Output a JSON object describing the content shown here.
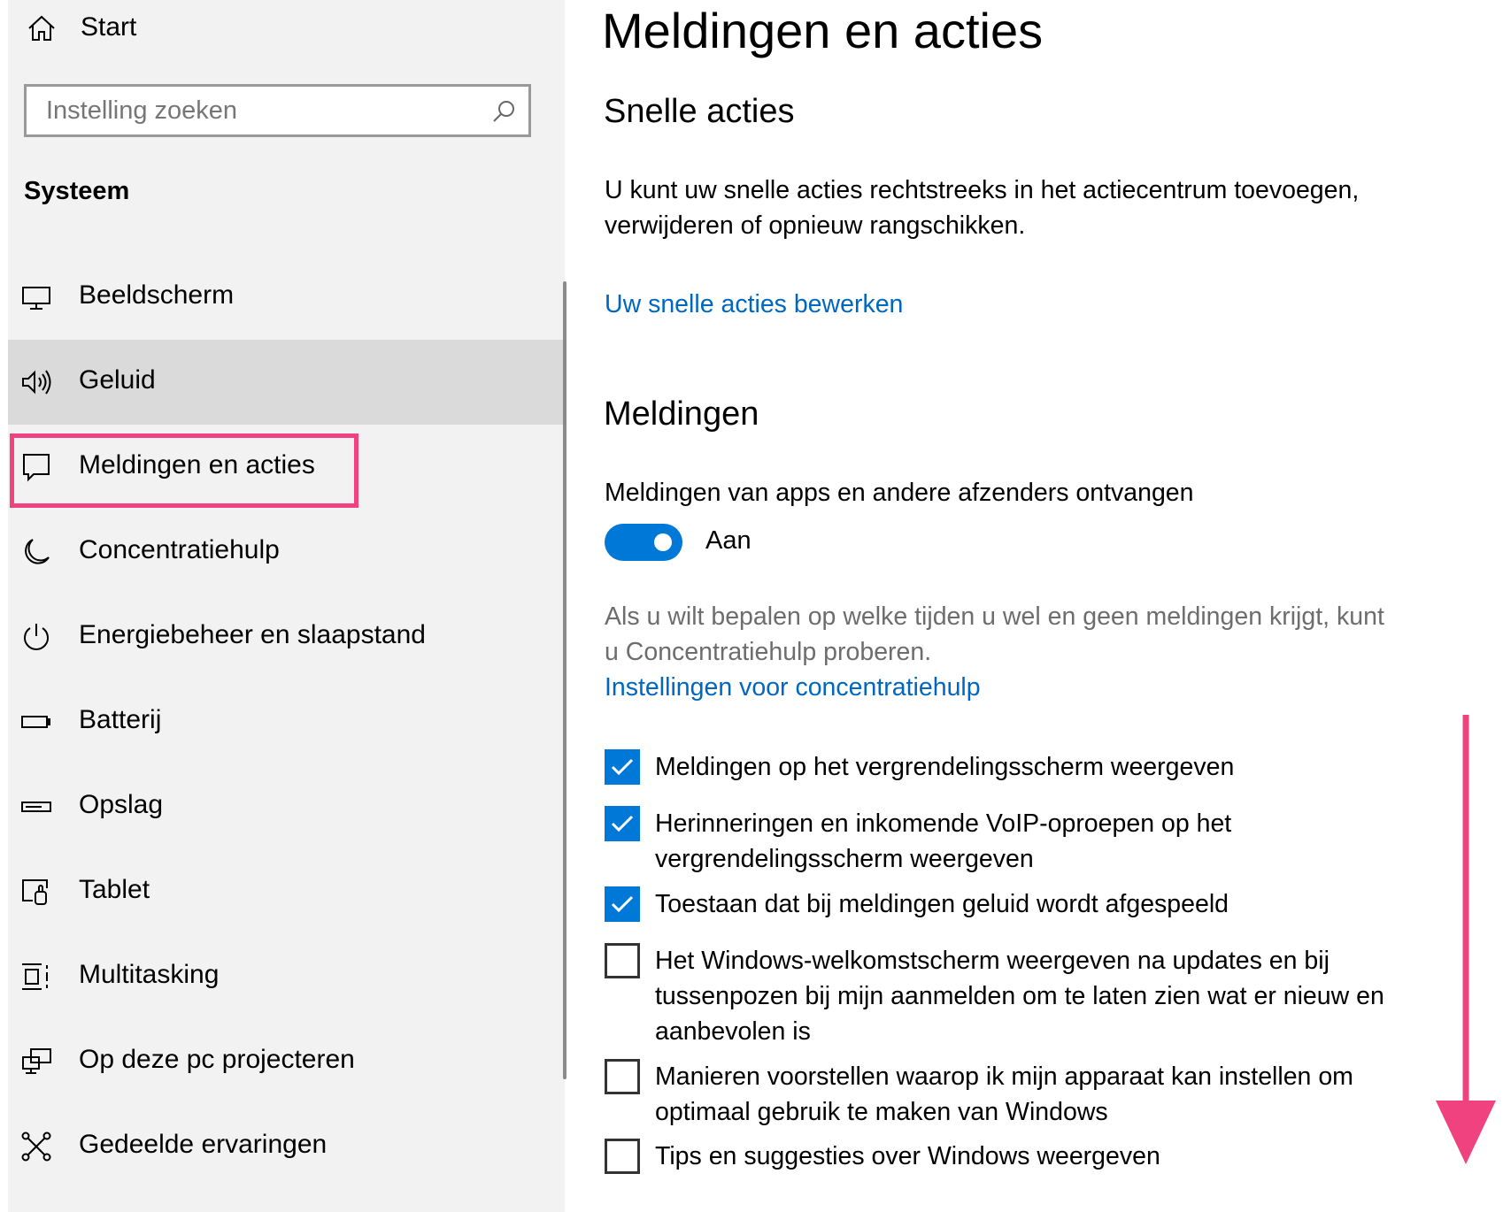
{
  "sidebar": {
    "home_label": "Start",
    "search_placeholder": "Instelling zoeken",
    "group_title": "Systeem",
    "items": [
      {
        "label": "Beeldscherm",
        "icon": "monitor-icon"
      },
      {
        "label": "Geluid",
        "icon": "speaker-icon"
      },
      {
        "label": "Meldingen en acties",
        "icon": "notification-icon"
      },
      {
        "label": "Concentratiehulp",
        "icon": "moon-icon"
      },
      {
        "label": "Energiebeheer en slaapstand",
        "icon": "power-icon"
      },
      {
        "label": "Batterij",
        "icon": "battery-icon"
      },
      {
        "label": "Opslag",
        "icon": "storage-icon"
      },
      {
        "label": "Tablet",
        "icon": "tablet-icon"
      },
      {
        "label": "Multitasking",
        "icon": "multitasking-icon"
      },
      {
        "label": "Op deze pc projecteren",
        "icon": "project-icon"
      },
      {
        "label": "Gedeelde ervaringen",
        "icon": "shared-experiences-icon"
      }
    ]
  },
  "main": {
    "title": "Meldingen en acties",
    "quick_actions": {
      "heading": "Snelle acties",
      "description": "U kunt uw snelle acties rechtstreeks in het actiecentrum toevoegen, verwijderen of opnieuw rangschikken.",
      "link": "Uw snelle acties bewerken"
    },
    "notifications": {
      "heading": "Meldingen",
      "toggle_label": "Meldingen van apps en andere afzenders ontvangen",
      "toggle_state": "Aan",
      "focus_text": "Als u wilt bepalen op welke tijden u wel en geen meldingen krijgt, kunt u Concentratiehulp proberen.",
      "focus_link": "Instellingen voor concentratiehulp",
      "checkboxes": [
        {
          "label": "Meldingen op het vergrendelingsscherm weergeven",
          "checked": true
        },
        {
          "label": "Herinneringen en inkomende VoIP-oproepen op het vergrendelingsscherm weergeven",
          "checked": true
        },
        {
          "label": "Toestaan dat bij meldingen geluid wordt afgespeeld",
          "checked": true
        },
        {
          "label": "Het Windows-welkomstscherm weergeven na updates en bij tussenpozen bij mijn aanmelden om te laten zien wat er nieuw en aanbevolen is",
          "checked": false
        },
        {
          "label": "Manieren voorstellen waarop ik mijn apparaat kan instellen om optimaal gebruik te maken van Windows",
          "checked": false
        },
        {
          "label": "Tips en suggesties over Windows weergeven",
          "checked": false
        }
      ]
    }
  },
  "colors": {
    "accent": "#0078d7",
    "link": "#0067c0",
    "annotation": "#f0427e"
  }
}
